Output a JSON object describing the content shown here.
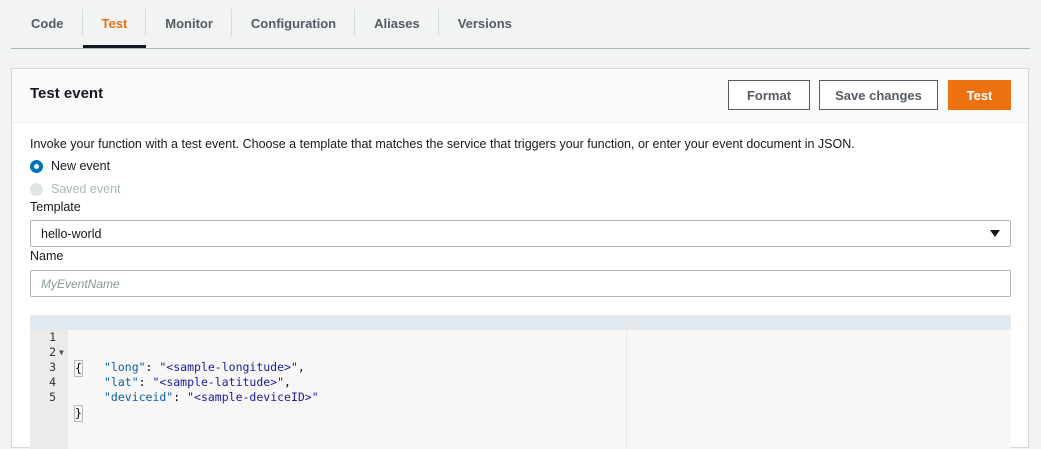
{
  "tabs": [
    {
      "label": "Code"
    },
    {
      "label": "Test"
    },
    {
      "label": "Monitor"
    },
    {
      "label": "Configuration"
    },
    {
      "label": "Aliases"
    },
    {
      "label": "Versions"
    }
  ],
  "active_tab": "Test",
  "panel": {
    "title": "Test event",
    "buttons": {
      "format": "Format",
      "save": "Save changes",
      "test": "Test"
    },
    "description": "Invoke your function with a test event. Choose a template that matches the service that triggers your function, or enter your event document in JSON.",
    "radios": {
      "new_event": "New event",
      "saved_event": "Saved event"
    },
    "template": {
      "label": "Template",
      "value": "hello-world"
    },
    "name": {
      "label": "Name",
      "placeholder": "MyEventName"
    }
  },
  "editor": {
    "lines": [
      {
        "num": "1",
        "text": "{"
      },
      {
        "num": "2",
        "key": "\"long\"",
        "value": "\"<sample-longitude>\"",
        "end": ","
      },
      {
        "num": "3",
        "key": "\"lat\"",
        "value": "\"<sample-latitude>\"",
        "end": ","
      },
      {
        "num": "4",
        "key": "\"deviceid\"",
        "value": "\"<sample-deviceID>\"",
        "end": ""
      },
      {
        "num": "5",
        "text": "}"
      }
    ]
  },
  "colors": {
    "accent": "#ec7211",
    "radio": "#0073bb",
    "text": "#16191f"
  }
}
